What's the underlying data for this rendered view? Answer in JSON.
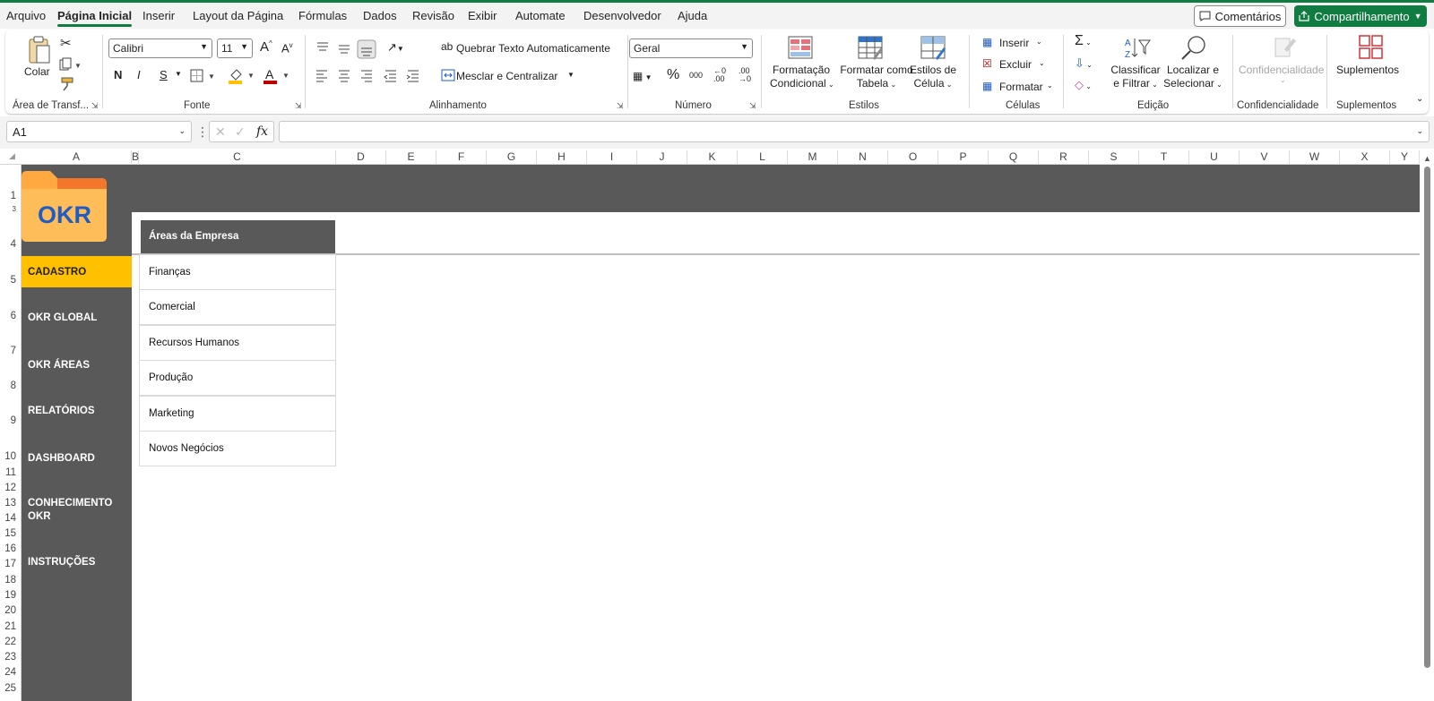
{
  "menu": {
    "tabs": [
      {
        "label": "Arquivo"
      },
      {
        "label": "Página Inicial"
      },
      {
        "label": "Inserir"
      },
      {
        "label": "Layout da Página"
      },
      {
        "label": "Fórmulas"
      },
      {
        "label": "Dados"
      },
      {
        "label": "Revisão"
      },
      {
        "label": "Exibir"
      },
      {
        "label": "Automate"
      },
      {
        "label": "Desenvolvedor"
      },
      {
        "label": "Ajuda"
      }
    ],
    "active_tab": "Página Inicial",
    "comments_label": "Comentários",
    "share_label": "Compartilhamento"
  },
  "ribbon": {
    "clipboard": {
      "paste_label": "Colar",
      "group_label": "Área de Transf..."
    },
    "font": {
      "font_name": "Calibri",
      "font_size": "11",
      "bold": "N",
      "italic": "I",
      "underline": "S",
      "group_label": "Fonte"
    },
    "alignment": {
      "wrap_text": "Quebrar Texto Automaticamente",
      "merge_center": "Mesclar e Centralizar",
      "group_label": "Alinhamento"
    },
    "number": {
      "format": "Geral",
      "percent": "%",
      "thousands": "000",
      "group_label": "Número"
    },
    "styles": {
      "conditional_line1": "Formatação",
      "conditional_line2": "Condicional",
      "table_line1": "Formatar como",
      "table_line2": "Tabela",
      "cell_line1": "Estilos de",
      "cell_line2": "Célula",
      "group_label": "Estilos"
    },
    "cells": {
      "insert": "Inserir",
      "delete": "Excluir",
      "format": "Formatar",
      "group_label": "Células"
    },
    "editing": {
      "sort_line1": "Classificar",
      "sort_line2": "e Filtrar",
      "find_line1": "Localizar e",
      "find_line2": "Selecionar",
      "group_label": "Edição"
    },
    "sensitivity": {
      "label": "Confidencialidade",
      "group_label": "Confidencialidade"
    },
    "addins": {
      "label": "Suplementos",
      "group_label": "Suplementos"
    }
  },
  "formula_bar": {
    "name_box": "A1",
    "fx": "fx",
    "formula": ""
  },
  "columns": [
    "A",
    "B",
    "C",
    "D",
    "E",
    "F",
    "G",
    "H",
    "I",
    "J",
    "K",
    "L",
    "M",
    "N",
    "O",
    "P",
    "Q",
    "R",
    "S",
    "T",
    "U",
    "V",
    "W",
    "X",
    "Y"
  ],
  "rows": [
    "1",
    "3",
    "4",
    "5",
    "6",
    "7",
    "8",
    "9",
    "10",
    "11",
    "12",
    "13",
    "14",
    "15",
    "16",
    "17",
    "18",
    "19",
    "20",
    "21",
    "22",
    "23",
    "24",
    "25"
  ],
  "sheet": {
    "logo_text": "OKR",
    "nav": [
      {
        "label": "CADASTRO",
        "active": true
      },
      {
        "label": "OKR GLOBAL"
      },
      {
        "label": "OKR ÁREAS"
      },
      {
        "label": "RELATÓRIOS"
      },
      {
        "label": "DASHBOARD"
      },
      {
        "label": "CONHECIMENTO OKR"
      },
      {
        "label": "INSTRUÇÕES"
      }
    ],
    "table_header": "Áreas da Empresa",
    "areas": [
      "Finanças",
      "Comercial",
      "Recursos Humanos",
      "Produção",
      "Marketing",
      "Novos Negócios"
    ]
  },
  "colors": {
    "accent": "#107c41",
    "sheet_dark": "#595959",
    "active_nav": "#ffc000",
    "logo_orange": "#ffa940",
    "logo_text": "#1f5cc4"
  }
}
